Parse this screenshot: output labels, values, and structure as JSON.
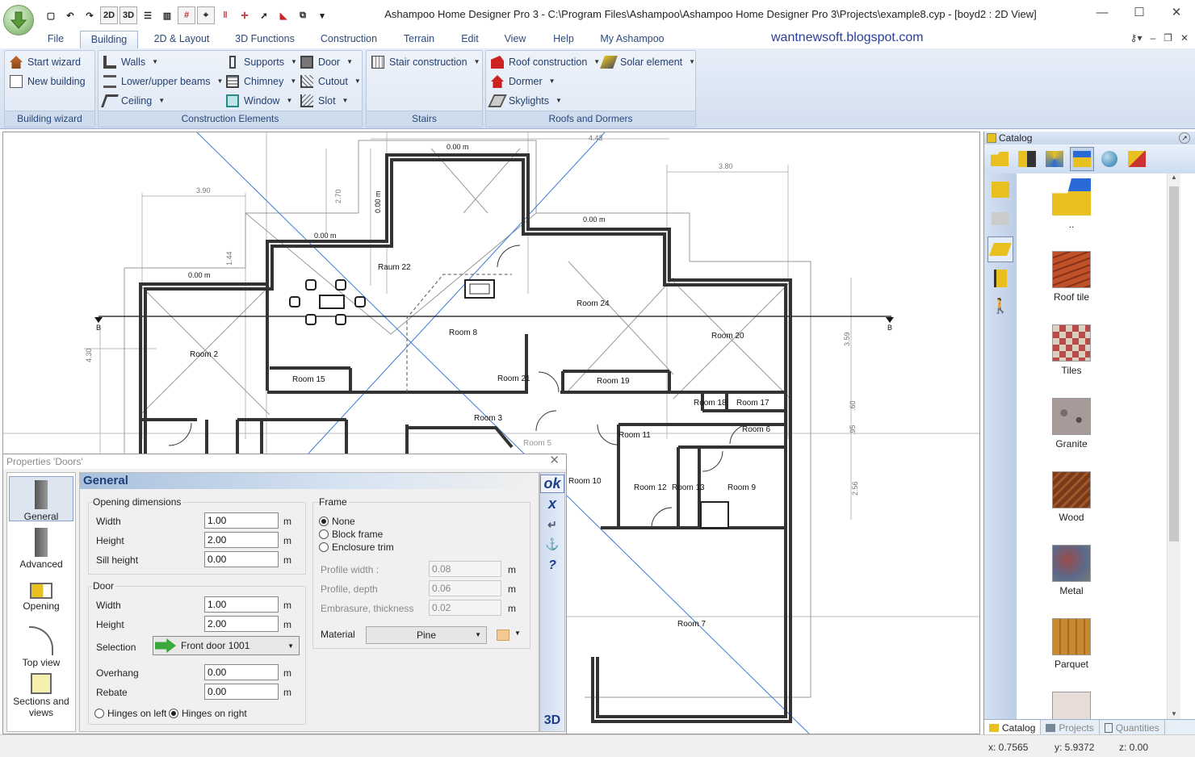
{
  "window": {
    "title": "Ashampoo Home Designer Pro 3 - C:\\Program Files\\Ashampoo\\Ashampoo Home Designer Pro 3\\Projects\\example8.cyp - [boyd2 : 2D View]"
  },
  "qat": {
    "view2d": "2D",
    "view3d": "3D"
  },
  "menu": {
    "tabs": [
      "File",
      "Building",
      "2D & Layout",
      "3D Functions",
      "Construction",
      "Terrain",
      "Edit",
      "View",
      "Help",
      "My Ashampoo"
    ],
    "active": "Building"
  },
  "watermark": "wantnewsoft.blogspot.com",
  "ribbon": {
    "building_wizard": {
      "caption": "Building wizard",
      "items": [
        "Start wizard",
        "New building"
      ]
    },
    "construction": {
      "caption": "Construction Elements",
      "col1": [
        "Walls",
        "Lower/upper beams",
        "Ceiling"
      ],
      "col2": [
        "Supports",
        "Chimney",
        "Window"
      ],
      "col3": [
        "Door",
        "Cutout",
        "Slot"
      ]
    },
    "stairs": {
      "caption": "Stairs",
      "items": [
        "Stair construction"
      ]
    },
    "roofs": {
      "caption": "Roofs and Dormers",
      "items": [
        "Roof construction",
        "Dormer",
        "Skylights"
      ],
      "solar": "Solar element"
    }
  },
  "plan": {
    "dims": [
      "0.00 m",
      "0.00 m",
      "0.00 m",
      "0.00 m",
      "0.00 m",
      "3.90",
      "2.70",
      "4.43",
      "3.80",
      "1.44",
      "4.30",
      "3.59",
      "2.56",
      ".60",
      ".95"
    ],
    "rooms": [
      "Raum 22",
      "Room 2",
      "Room 8",
      "Room 24",
      "Room 20",
      "Room 15",
      "Room 21",
      "Room 19",
      "Room 3",
      "Room 18",
      "Room 17",
      "Room 6",
      "Room 11",
      "Room 12",
      "Room 13",
      "Room 9",
      "Room 10",
      "Room 7",
      "Room 5"
    ],
    "section": "B"
  },
  "catalog": {
    "title": "Catalog",
    "items": [
      "..",
      "Roof tile",
      "Tiles",
      "Granite",
      "Wood",
      "Metal",
      "Parquet"
    ],
    "tabs": [
      "Catalog",
      "Projects",
      "Quantities"
    ]
  },
  "properties": {
    "title": "Properties 'Doors'",
    "nav": [
      "General",
      "Advanced",
      "Opening",
      "Top view",
      "Sections and views"
    ],
    "heading": "General",
    "opening": {
      "legend": "Opening dimensions",
      "width_label": "Width",
      "width": "1.00",
      "height_label": "Height",
      "height": "2.00",
      "sill_label": "Sill height",
      "sill": "0.00"
    },
    "door": {
      "legend": "Door",
      "width_label": "Width",
      "width": "1.00",
      "height_label": "Height",
      "height": "2.00",
      "selection_label": "Selection",
      "selection": "Front door 1001",
      "overhang_label": "Overhang",
      "overhang": "0.00",
      "rebate_label": "Rebate",
      "rebate": "0.00",
      "hinge_left": "Hinges on left",
      "hinge_right": "Hinges on right"
    },
    "frame": {
      "legend": "Frame",
      "options": [
        "None",
        "Block frame",
        "Enclosure trim"
      ],
      "profile_width_label": "Profile width :",
      "profile_width": "0.08",
      "profile_depth_label": "Profile, depth",
      "profile_depth": "0.06",
      "embrasure_label": "Embrasure, thickness",
      "embrasure": "0.02",
      "material_label": "Material",
      "material": "Pine"
    },
    "unit": "m",
    "side": {
      "ok": "ok",
      "cancel": "x",
      "help": "?",
      "view3d": "3D"
    }
  },
  "status": {
    "x": "x: 0.7565",
    "y": "y: 5.9372",
    "z": "z: 0.00"
  }
}
